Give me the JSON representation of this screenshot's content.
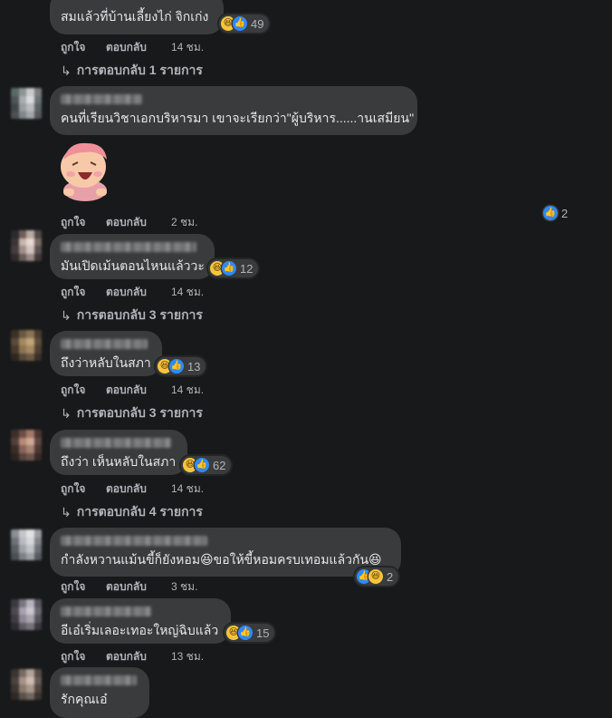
{
  "comments": [
    {
      "text": "สมแล้วที่บ้านเลี้ยงไก่ จิกเก่ง",
      "reaction_count": "49",
      "like_label": "ถูกใจ",
      "reply_label": "ตอบกลับ",
      "time": "14 ชม.",
      "replies_label": "การตอบกลับ 1 รายการ"
    },
    {
      "text": "คนที่เรียนวิชาเอกบริหารมา เขาจะเรียกว่า\"ผู้บริหาร......านเสมียน\"",
      "reaction_count": "2",
      "like_label": "ถูกใจ",
      "reply_label": "ตอบกลับ",
      "time": "2 ชม."
    },
    {
      "text": "มันเปิดเม้นตอนไหนแล้ววะ",
      "reaction_count": "12",
      "like_label": "ถูกใจ",
      "reply_label": "ตอบกลับ",
      "time": "14 ชม.",
      "replies_label": "การตอบกลับ 3 รายการ"
    },
    {
      "text": "ถึงว่าหลับในสภา",
      "reaction_count": "13",
      "like_label": "ถูกใจ",
      "reply_label": "ตอบกลับ",
      "time": "14 ชม.",
      "replies_label": "การตอบกลับ 3 รายการ"
    },
    {
      "text": "ถึงว่า เห็นหลับในสภา",
      "reaction_count": "62",
      "like_label": "ถูกใจ",
      "reply_label": "ตอบกลับ",
      "time": "14 ชม.",
      "replies_label": "การตอบกลับ 4 รายการ"
    },
    {
      "text": "กำลังหวานแม้นขี้ก็ยังหอม😆ขอให้ขี้หอมครบเทอมแล้วกัน😆",
      "reaction_count": "2",
      "like_label": "ถูกใจ",
      "reply_label": "ตอบกลับ",
      "time": "3 ชม."
    },
    {
      "text": "อีเอ๋เริ่มเลอะเทอะใหญ่ฉิบแล้ว",
      "reaction_count": "15",
      "like_label": "ถูกใจ",
      "reply_label": "ตอบกลับ",
      "time": "13 ชม."
    },
    {
      "text": "รักคุณเอ๋"
    }
  ],
  "icons": {
    "like": "thumbs-up-icon",
    "haha": "laughing-face-icon",
    "reply_arrow": "reply-arrow-icon"
  },
  "colors": {
    "background": "#18191a",
    "bubble": "#3a3b3c",
    "like_blue": "#2e89ff",
    "haha_yellow": "#f7c53c",
    "meta_text": "#b0b3b8"
  }
}
